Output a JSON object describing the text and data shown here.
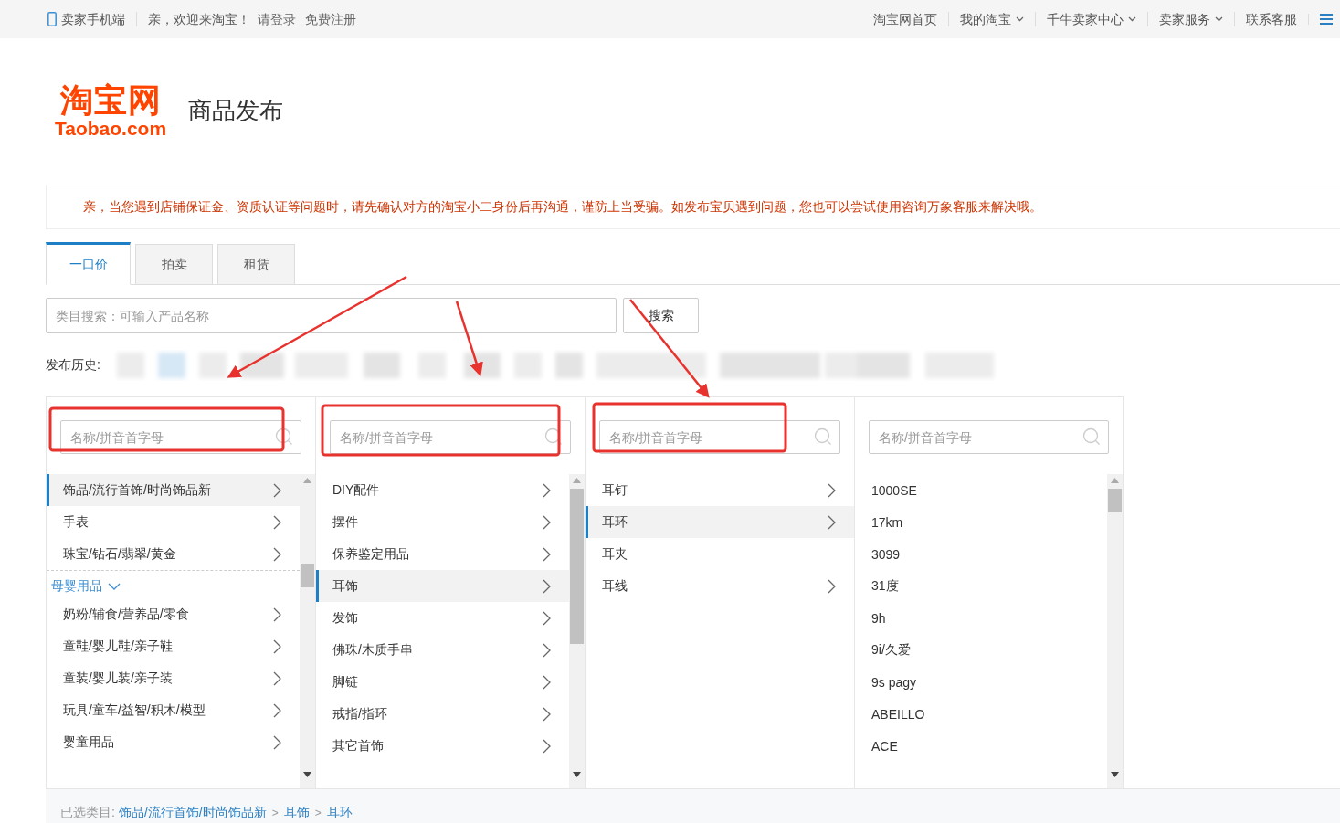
{
  "top_bar": {
    "left": [
      {
        "kind": "mobile",
        "label": "卖家手机端"
      },
      {
        "kind": "text",
        "label": "亲，欢迎来淘宝！"
      },
      {
        "kind": "link",
        "label": "请登录"
      },
      {
        "kind": "link",
        "label": "免费注册"
      }
    ],
    "right": [
      {
        "label": "淘宝网首页",
        "dropdown": false
      },
      {
        "label": "我的淘宝",
        "dropdown": true
      },
      {
        "label": "千牛卖家中心",
        "dropdown": true
      },
      {
        "label": "卖家服务",
        "dropdown": true
      },
      {
        "label": "联系客服",
        "dropdown": false
      }
    ]
  },
  "logo": {
    "title": "淘宝网",
    "subtitle": "Taobao.com"
  },
  "page_title": "商品发布",
  "notice": "亲，当您遇到店铺保证金、资质认证等问题时，请先确认对方的淘宝小二身份后再沟通，谨防上当受骗。如发布宝贝遇到问题，您也可以尝试使用咨询万象客服来解决哦。",
  "tabs": [
    {
      "label": "一口价",
      "selected": true
    },
    {
      "label": "拍卖",
      "selected": false
    },
    {
      "label": "租赁",
      "selected": false
    }
  ],
  "search": {
    "placeholder": "类目搜索：可输入产品名称",
    "button": "搜索"
  },
  "history": {
    "label": "发布历史:"
  },
  "columns": [
    {
      "placeholder": "名称/拼音首字母",
      "scrollable": true,
      "items": [
        {
          "kind": "item",
          "label": "饰品/流行首饰/时尚饰品新",
          "selected": true,
          "has_children": true
        },
        {
          "kind": "item",
          "label": "手表",
          "selected": false,
          "has_children": true
        },
        {
          "kind": "item",
          "label": "珠宝/钻石/翡翠/黄金",
          "selected": false,
          "has_children": true
        },
        {
          "kind": "group",
          "label": "母婴用品",
          "expanded": true
        },
        {
          "kind": "item",
          "label": "奶粉/辅食/营养品/零食",
          "selected": false,
          "has_children": true
        },
        {
          "kind": "item",
          "label": "童鞋/婴儿鞋/亲子鞋",
          "selected": false,
          "has_children": true
        },
        {
          "kind": "item",
          "label": "童装/婴儿装/亲子装",
          "selected": false,
          "has_children": true
        },
        {
          "kind": "item",
          "label": "玩具/童车/益智/积木/模型",
          "selected": false,
          "has_children": true
        },
        {
          "kind": "item",
          "label": "婴童用品",
          "selected": false,
          "has_children": true
        }
      ]
    },
    {
      "placeholder": "名称/拼音首字母",
      "scrollable": true,
      "items": [
        {
          "kind": "item",
          "label": "DIY配件",
          "selected": false,
          "has_children": true
        },
        {
          "kind": "item",
          "label": "摆件",
          "selected": false,
          "has_children": true
        },
        {
          "kind": "item",
          "label": "保养鉴定用品",
          "selected": false,
          "has_children": true
        },
        {
          "kind": "item",
          "label": "耳饰",
          "selected": true,
          "has_children": true
        },
        {
          "kind": "item",
          "label": "发饰",
          "selected": false,
          "has_children": true
        },
        {
          "kind": "item",
          "label": "佛珠/木质手串",
          "selected": false,
          "has_children": true
        },
        {
          "kind": "item",
          "label": "脚链",
          "selected": false,
          "has_children": true
        },
        {
          "kind": "item",
          "label": "戒指/指环",
          "selected": false,
          "has_children": true
        },
        {
          "kind": "item",
          "label": "其它首饰",
          "selected": false,
          "has_children": true
        }
      ]
    },
    {
      "placeholder": "名称/拼音首字母",
      "scrollable": false,
      "items": [
        {
          "kind": "item",
          "label": "耳钉",
          "selected": false,
          "has_children": true
        },
        {
          "kind": "item",
          "label": "耳环",
          "selected": true,
          "has_children": true
        },
        {
          "kind": "item",
          "label": "耳夹",
          "selected": false,
          "has_children": false
        },
        {
          "kind": "item",
          "label": "耳线",
          "selected": false,
          "has_children": true
        }
      ]
    },
    {
      "placeholder": "名称/拼音首字母",
      "scrollable": true,
      "items": [
        {
          "kind": "item",
          "label": "1000SE",
          "selected": false,
          "has_children": false
        },
        {
          "kind": "item",
          "label": "17km",
          "selected": false,
          "has_children": false
        },
        {
          "kind": "item",
          "label": "3099",
          "selected": false,
          "has_children": false
        },
        {
          "kind": "item",
          "label": "31度",
          "selected": false,
          "has_children": false
        },
        {
          "kind": "item",
          "label": "9h",
          "selected": false,
          "has_children": false
        },
        {
          "kind": "item",
          "label": "9i/久爱",
          "selected": false,
          "has_children": false
        },
        {
          "kind": "item",
          "label": "9s pagy",
          "selected": false,
          "has_children": false
        },
        {
          "kind": "item",
          "label": "ABEILLO",
          "selected": false,
          "has_children": false
        },
        {
          "kind": "item",
          "label": "ACE",
          "selected": false,
          "has_children": false
        }
      ]
    }
  ],
  "selected_path": {
    "label": "已选类目:",
    "parts": [
      "饰品/流行首饰/时尚饰品新",
      "耳饰",
      "耳环"
    ],
    "separator": ">"
  }
}
